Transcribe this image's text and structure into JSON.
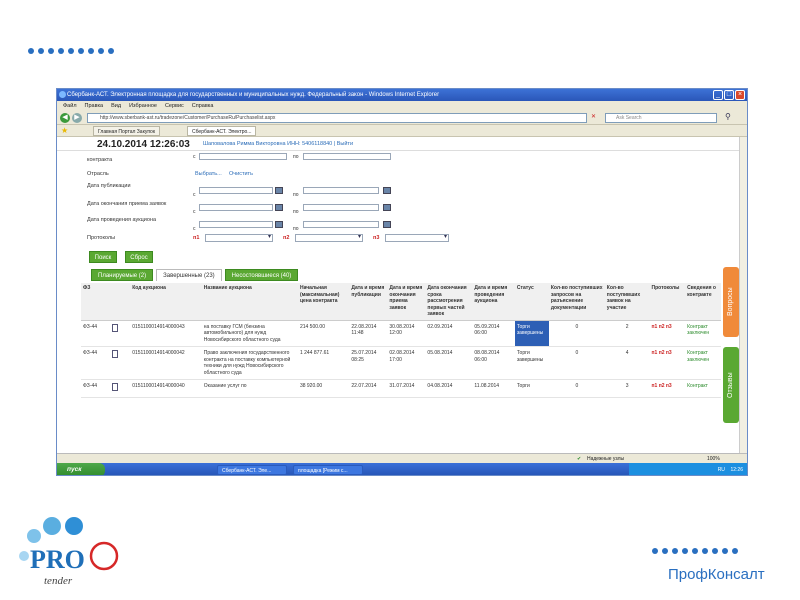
{
  "window": {
    "title": "Сбербанк-АСТ. Электронная площадка для государственных и муниципальных нужд. Федеральный закон - Windows Internet Explorer",
    "menu": [
      "Файл",
      "Правка",
      "Вид",
      "Избранное",
      "Сервис",
      "Справка"
    ],
    "url": "http://www.sberbank-ast.ru/tradezone/Customer/PurchaseRu/Purchaselist.aspx",
    "search_placeholder": "Ask Search",
    "browser_tabs": [
      "Главная Портал Закупок",
      "Сбербанк-АСТ. Электро..."
    ]
  },
  "header": {
    "datetime": "24.10.2014 12:26:03",
    "user": "Шаповалова Римма Викторовна ИНН: 5406118840 | Выйти"
  },
  "filters": {
    "contract_price_label": "контракта",
    "industry_label": "Отрасль",
    "industry_select": "Выбрать...",
    "industry_clear": "Очистить",
    "pub_date_label": "Дата публикации",
    "end_date_label": "Дата окончания приема заявок",
    "auction_date_label": "Дата проведения аукциона",
    "protocols_label": "Протоколы",
    "from": "с",
    "to": "по",
    "p1": "п1",
    "p2": "п2",
    "p3": "п3"
  },
  "buttons": {
    "search": "Поиск",
    "reset": "Сброс"
  },
  "tabs": [
    "Планируемые (2)",
    "Завершенные (23)",
    "Несостоявшиеся (40)"
  ],
  "table": {
    "headers": [
      "ФЗ",
      "",
      "Код аукциона",
      "Название аукциона",
      "Начальная (максимальная) цена контракта",
      "Дата и время публикации",
      "Дата и время окончания приема заявок",
      "Дата окончания срока рассмотрения первых частей заявок",
      "Дата и время проведения аукциона",
      "Статус",
      "Кол-во поступивших запросов на разъяснение документации",
      "Кол-во поступивших заявок на участие",
      "Протоколы",
      "Сведения о контракте"
    ],
    "rows": [
      {
        "fz": "ФЗ-44",
        "code": "0151100014914000043",
        "name": "на поставку ГСМ (бензина автомобильного) для нужд Новосибирского областного суда",
        "price": "214 500.00",
        "pub": "22.08.2014 11:48",
        "end": "30.08.2014 12:00",
        "review": "02.09.2014",
        "auction": "05.09.2014 06:00",
        "status": "Торги завершены",
        "requests": "0",
        "bids": "2",
        "protocols": "п1 п2 п3",
        "contract": "Контракт заключен"
      },
      {
        "fz": "ФЗ-44",
        "code": "0151100014914000042",
        "name": "Право заключения государственного контракта на поставку компьютерной техники для нужд Новосибирского областного суда",
        "price": "1 244 877.61",
        "pub": "25.07.2014 08:25",
        "end": "02.08.2014 17:00",
        "review": "05.08.2014",
        "auction": "08.08.2014 06:00",
        "status": "Торги завершены",
        "requests": "0",
        "bids": "4",
        "protocols": "п1 п2 п3",
        "contract": "Контракт заключен"
      },
      {
        "fz": "ФЗ-44",
        "code": "0151100014914000040",
        "name": "Оказание услуг по",
        "price": "38 920.00",
        "pub": "22.07.2014",
        "end": "31.07.2014",
        "review": "04.08.2014",
        "auction": "11.08.2014",
        "status": "Торги",
        "requests": "0",
        "bids": "3",
        "protocols": "п1 п2 п3",
        "contract": "Контракт"
      }
    ]
  },
  "side_tabs": {
    "questions": "Вопросы",
    "reviews": "Отзывы"
  },
  "statusbar": {
    "trusted": "Надежные узлы",
    "zoom": "100%"
  },
  "taskbar": {
    "start": "пуск",
    "task1": "Сбербанк-АСТ. Эле...",
    "task2": "площадка [Режим с...",
    "time": "12:26",
    "lang": "RU"
  },
  "brand": {
    "name": "ПрофКонсалт",
    "logo_text": "PRO",
    "logo_sub": "tender"
  },
  "colors": {
    "accent": "#2a6fc0",
    "green": "#5aa832",
    "orange": "#f08a3a"
  }
}
